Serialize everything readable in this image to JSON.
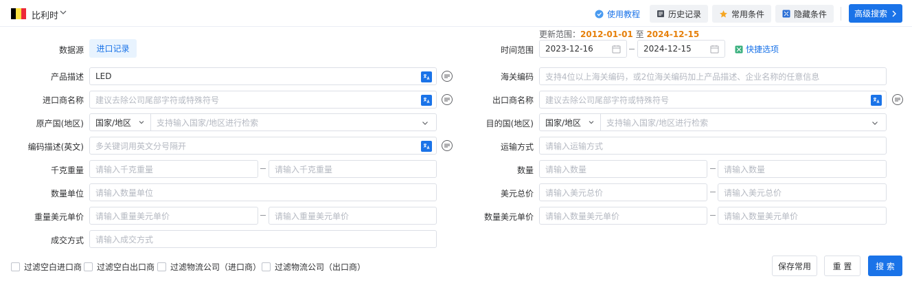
{
  "header": {
    "country": "比利时",
    "flag_colors": [
      "#000000",
      "#fae042",
      "#ed2939"
    ],
    "tutorial_link": "使用教程",
    "history_btn": "历史记录",
    "favorites_btn": "常用条件",
    "hide_btn": "隐藏条件",
    "advanced_btn": "高级搜索"
  },
  "range_note": {
    "prefix": "更新范围：",
    "start": "2012-01-01",
    "middle": "至",
    "end": "2024-12-15"
  },
  "left": {
    "datasource_label": "数据源",
    "datasource_value": "进口记录",
    "product_label": "产品描述",
    "product_value": "LED",
    "importer_label": "进口商名称",
    "importer_placeholder": "建议去除公司尾部字符或特殊符号",
    "origin_label": "原产国(地区)",
    "origin_prefix": "国家/地区",
    "origin_placeholder": "支持输入国家/地区进行检索",
    "code_desc_label": "编码描述(英文)",
    "code_desc_placeholder": "多关键词用英文分号隔开",
    "weight_label": "千克重量",
    "weight_placeholder": "请输入千克重量",
    "qty_unit_label": "数量单位",
    "qty_unit_placeholder": "请输入数量单位",
    "weight_price_label": "重量美元单价",
    "weight_price_placeholder": "请输入重量美元单价",
    "deal_label": "成交方式",
    "deal_placeholder": "请输入成交方式"
  },
  "right": {
    "time_label": "时间范围",
    "date_start": "2023-12-16",
    "date_end": "2024-12-15",
    "quick_options": "快捷选项",
    "hs_label": "海关编码",
    "hs_placeholder": "支持4位以上海关编码，或2位海关编码加上产品描述、企业名称的任意信息",
    "exporter_label": "出口商名称",
    "exporter_placeholder": "建议去除公司尾部字符或特殊符号",
    "dest_label": "目的国(地区)",
    "dest_prefix": "国家/地区",
    "dest_placeholder": "支持输入国家/地区进行检索",
    "transport_label": "运输方式",
    "transport_placeholder": "请输入运输方式",
    "qty_label": "数量",
    "qty_placeholder": "请输入数量",
    "usd_total_label": "美元总价",
    "usd_total_placeholder": "请输入美元总价",
    "qty_price_label": "数量美元单价",
    "qty_price_placeholder": "请输入数量美元单价",
    "range_dash": "–"
  },
  "footer": {
    "filter1": "过滤空白进口商",
    "filter2": "过滤空白出口商",
    "filter3": "过滤物流公司（进口商）",
    "filter4": "过滤物流公司（出口商）",
    "save_btn": "保存常用",
    "reset_btn": "重 置",
    "search_btn": "搜 索"
  }
}
